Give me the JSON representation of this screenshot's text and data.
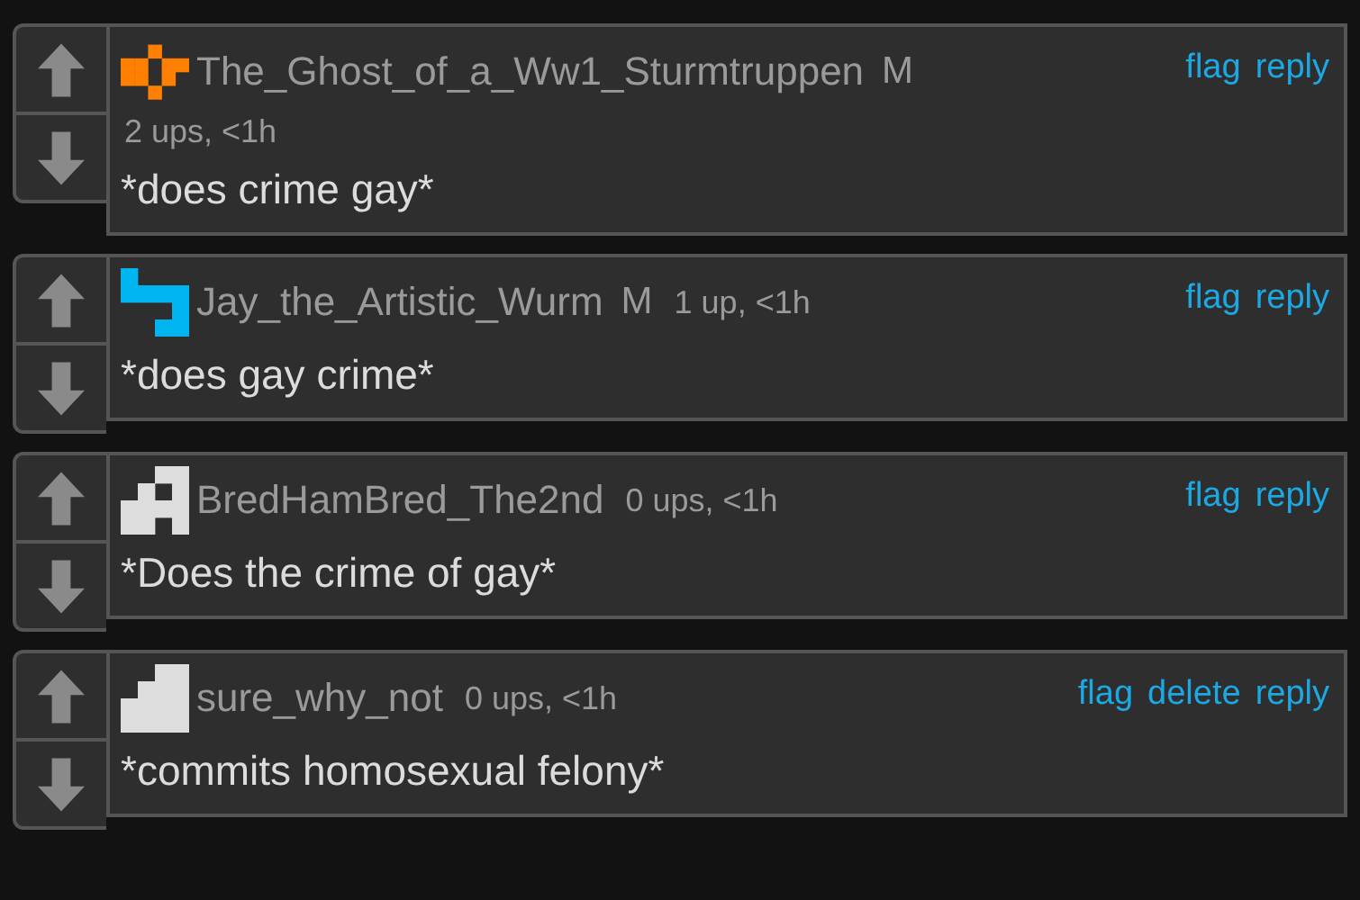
{
  "comments": [
    {
      "username": "The_Ghost_of_a_Ww1_Sturmtruppen",
      "badge": "M",
      "meta": "2 ups, <1h",
      "actions": [
        "flag",
        "reply"
      ],
      "text": "*does crime gay*",
      "avatar": {
        "color": "#ff7f00"
      }
    },
    {
      "username": "Jay_the_Artistic_Wurm",
      "badge": "M",
      "meta": "1 up, <1h",
      "actions": [
        "flag",
        "reply"
      ],
      "text": "*does gay crime*",
      "avatar": {
        "color": "#00b4f0"
      }
    },
    {
      "username": "BredHamBred_The2nd",
      "meta": "0 ups, <1h",
      "actions": [
        "flag",
        "reply"
      ],
      "text": "*Does the crime of gay*",
      "avatar": {
        "color": "#dddddd"
      }
    },
    {
      "username": "sure_why_not",
      "meta": "0 ups, <1h",
      "actions": [
        "flag",
        "delete",
        "reply"
      ],
      "text": "*commits homosexual felony*",
      "avatar": {
        "color": "#dddddd"
      }
    }
  ]
}
